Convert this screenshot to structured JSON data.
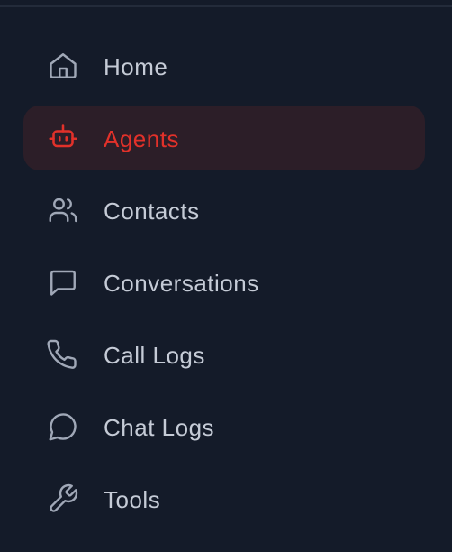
{
  "sidebar": {
    "active_color": "#e2312a",
    "items": [
      {
        "label": "Home",
        "icon": "home-icon",
        "active": false
      },
      {
        "label": "Agents",
        "icon": "robot-icon",
        "active": true
      },
      {
        "label": "Contacts",
        "icon": "users-icon",
        "active": false
      },
      {
        "label": "Conversations",
        "icon": "message-square-icon",
        "active": false
      },
      {
        "label": "Call Logs",
        "icon": "phone-icon",
        "active": false
      },
      {
        "label": "Chat Logs",
        "icon": "message-circle-icon",
        "active": false
      },
      {
        "label": "Tools",
        "icon": "wrench-icon",
        "active": false
      }
    ]
  }
}
